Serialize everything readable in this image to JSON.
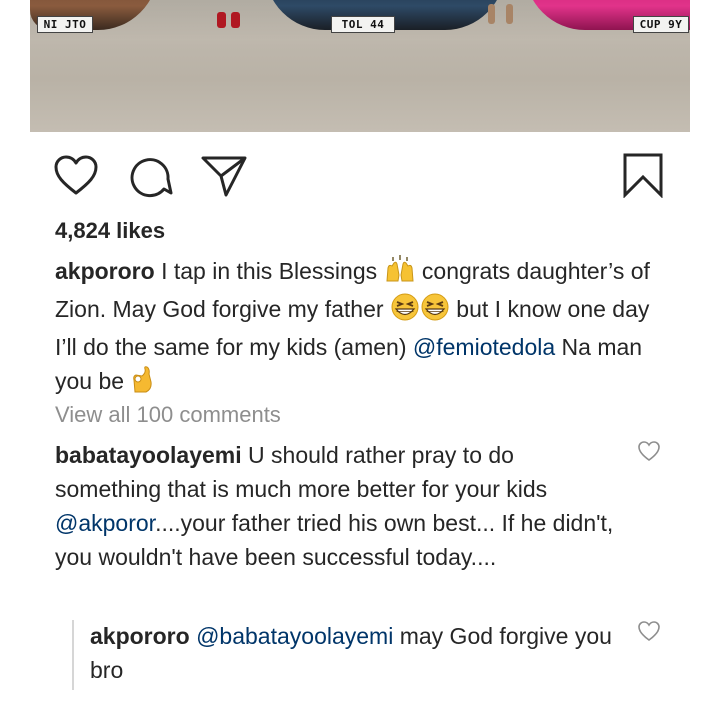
{
  "photo": {
    "plates": [
      "NI JTO",
      "TOL 44",
      "CUP 9Y"
    ]
  },
  "post": {
    "likes": "4,824 likes",
    "caption": {
      "username": "akpororo",
      "text_1": " I tap in this Blessings ",
      "emoji_1": "raised-hands",
      "text_2": " congrats daughter’s of Zion. May God forgive my father ",
      "emoji_2": "grinning-squinting-face",
      "emoji_3": "grinning-squinting-face",
      "text_3": " but I know one day I’ll do the same for my kids (amen) ",
      "mention": "@femiotedola",
      "text_4": " Na man you be ",
      "emoji_4": "ok-hand"
    },
    "view_all_comments": "View all 100 comments"
  },
  "comments": [
    {
      "username": "babatayoolayemi",
      "text_1": " U should rather pray to do something that is much more better for your kids ",
      "mention": "@akporor",
      "text_2": "....your father tried his own best... If he didn't, you wouldn't have been successful today...."
    }
  ],
  "replies": [
    {
      "username": "akpororo",
      "text_1": " ",
      "mention": "@babatayoolayemi",
      "text_2": " may God forgive you bro"
    }
  ],
  "icons": [
    "heart-icon",
    "comment-icon",
    "share-icon",
    "bookmark-icon"
  ],
  "colors": {
    "text": "#262626",
    "muted": "#8e8e8e",
    "mention": "#003569"
  }
}
